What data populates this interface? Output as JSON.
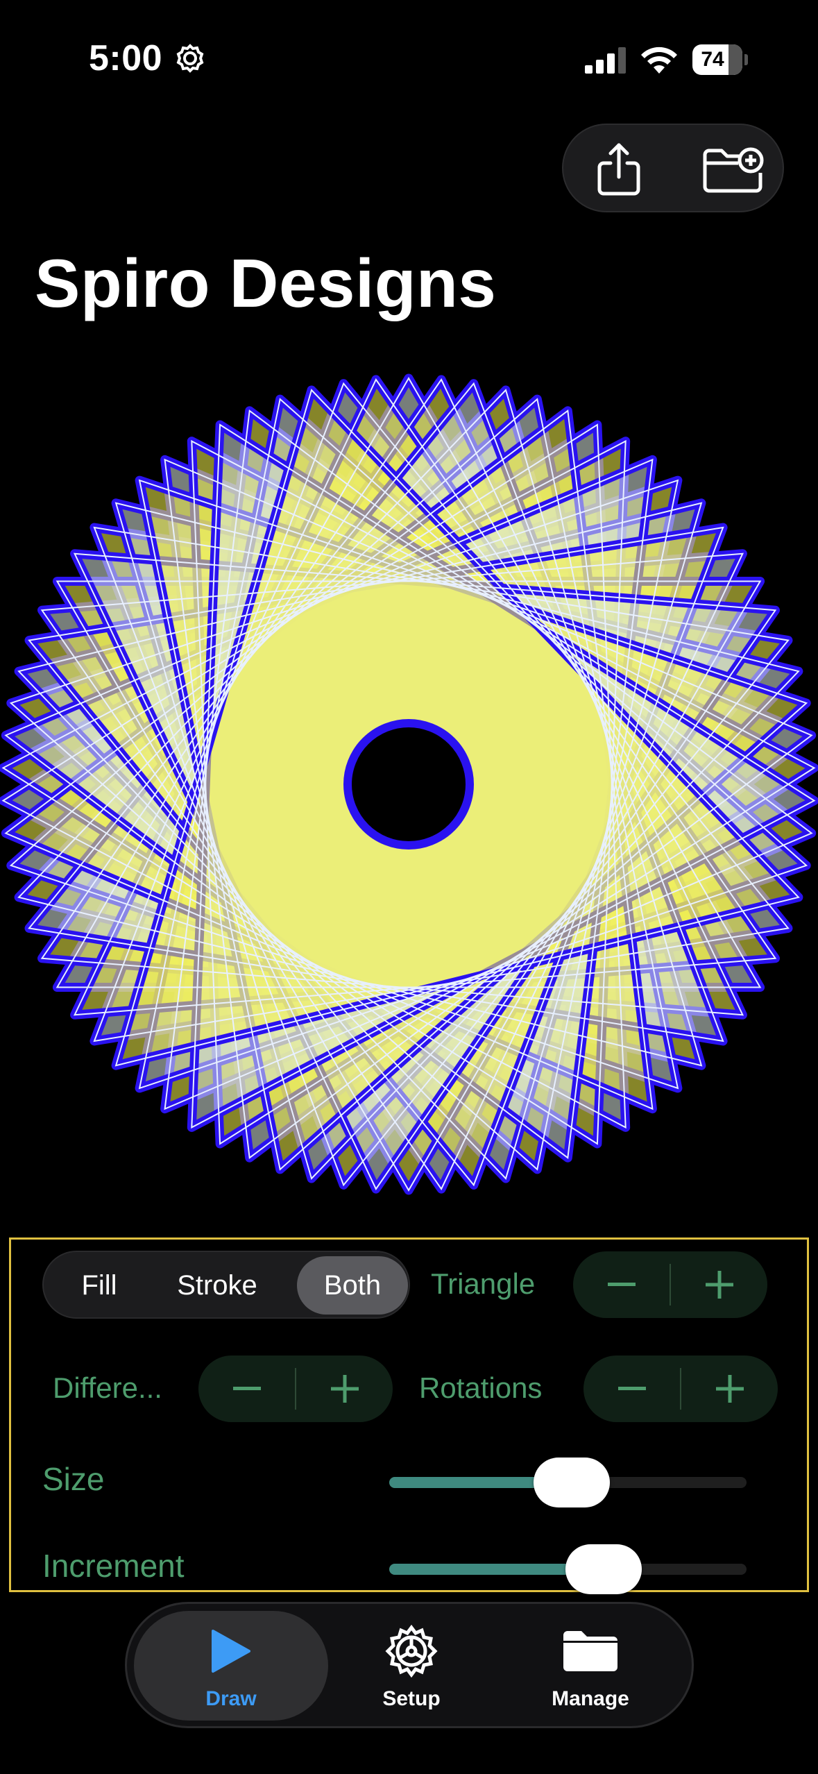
{
  "status_bar": {
    "time": "5:00",
    "battery_level": "74",
    "icons": [
      "gear-icon",
      "cellular-signal-icon",
      "wifi-icon",
      "battery-icon"
    ]
  },
  "toolbar": {
    "buttons": [
      {
        "name": "share",
        "icon": "share-icon"
      },
      {
        "name": "new-folder",
        "icon": "folder-plus-icon"
      }
    ]
  },
  "page": {
    "title": "Spiro Designs"
  },
  "design": {
    "shape": "Triangle",
    "render_mode": "Both",
    "colors": {
      "fill": "#f4f24a",
      "fill_light": "#d8e6de",
      "stroke": "#2a12f0",
      "background": "#000000"
    }
  },
  "controls": {
    "render_modes": [
      "Fill",
      "Stroke",
      "Both"
    ],
    "selected_mode": "Both",
    "shape_label": "Triangle",
    "difference_label": "Differe...",
    "rotations_label": "Rotations",
    "size_label": "Size",
    "size_value": 0.51,
    "increment_label": "Increment",
    "increment_value": 0.6,
    "stepper_minus": "−",
    "stepper_plus": "+",
    "label_color": "#4e9d6d",
    "slider_color": "#3f8a80"
  },
  "tabbar": {
    "tabs": [
      {
        "label": "Draw",
        "icon": "play-icon",
        "selected": true
      },
      {
        "label": "Setup",
        "icon": "gear-icon",
        "selected": false
      },
      {
        "label": "Manage",
        "icon": "folder-icon",
        "selected": false
      }
    ],
    "accent": "#3d9bf5"
  }
}
